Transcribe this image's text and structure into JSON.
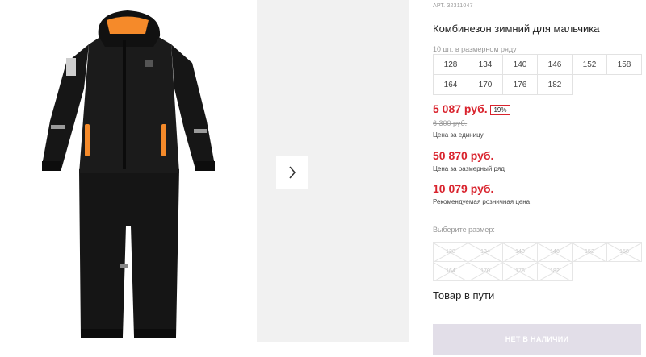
{
  "product": {
    "sku_label": "АРТ.",
    "sku_value": "32311047",
    "title": "Комбинезон зимний для мальчика",
    "sizes_caption": "10 шт. в размерном ряду",
    "sizes": [
      "128",
      "134",
      "140",
      "146",
      "152",
      "158",
      "164",
      "170",
      "176",
      "182"
    ]
  },
  "pricing": {
    "unit_price": "5 087 руб.",
    "discount": "19%",
    "old_price": "6 300 руб.",
    "unit_label": "Цена за единицу",
    "row_price": "50 870 руб.",
    "row_label": "Цена за размерный ряд",
    "rrp_price": "10 079 руб.",
    "rrp_label": "Рекомендуемая розничная цена"
  },
  "size_picker": {
    "label": "Выберите размер:",
    "options": [
      "128",
      "134",
      "140",
      "146",
      "152",
      "158",
      "164",
      "170",
      "176",
      "182"
    ]
  },
  "status": {
    "in_transit": "Товар в пути"
  },
  "actions": {
    "out_of_stock": "НЕТ В НАЛИЧИИ"
  },
  "gallery": {
    "next_icon": "chevron-right-icon"
  },
  "colors": {
    "price_red": "#d9232d",
    "button_disabled": "#e2dee8",
    "accent_orange": "#f58a2a"
  }
}
